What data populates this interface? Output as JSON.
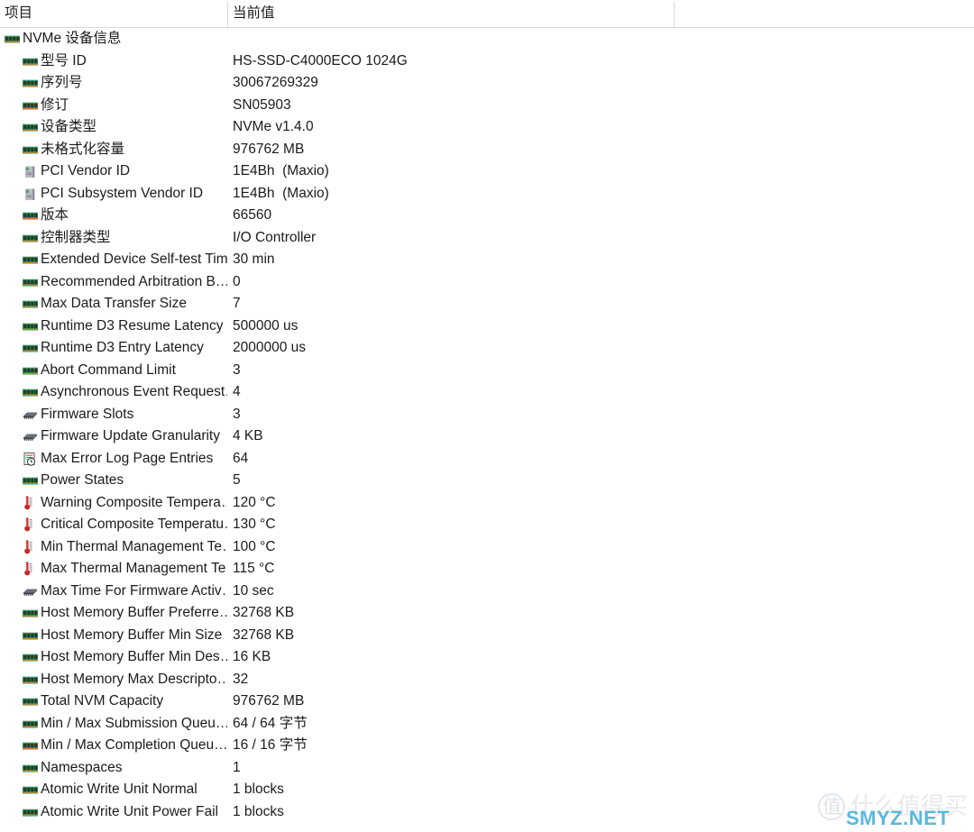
{
  "window": {
    "title": "NVMe 设备信息"
  },
  "header": {
    "columns": [
      {
        "label": "项目"
      },
      {
        "label": "当前值"
      }
    ]
  },
  "colors": {
    "text": "#1b1b1b",
    "grid_line": "#d6d9de",
    "background": "#ffffff",
    "memory_icon_green": "#2f8b57",
    "memory_icon_dark": "#23402f",
    "thermometer_red": "#c62828",
    "chip_icon_grey": "#55585c",
    "watermark_accent": "#5bb8dd",
    "watermark_grey": "#e3e6ea"
  },
  "watermark": {
    "mark_char": "值",
    "brand_cn": "什么值得买",
    "site": "SMYZ.NET"
  },
  "rows": [
    {
      "icon": "memory-icon",
      "depth": 0,
      "label": "NVMe 设备信息",
      "value": ""
    },
    {
      "icon": "memory-icon",
      "depth": 1,
      "label": "型号 ID",
      "value": "HS-SSD-C4000ECO 1024G"
    },
    {
      "icon": "memory-icon",
      "depth": 1,
      "label": "序列号",
      "value": "30067269329"
    },
    {
      "icon": "memory-icon",
      "depth": 1,
      "label": "修订",
      "value": "SN05903"
    },
    {
      "icon": "memory-icon",
      "depth": 1,
      "label": "设备类型",
      "value": "NVMe v1.4.0"
    },
    {
      "icon": "memory-icon",
      "depth": 1,
      "label": "未格式化容量",
      "value": "976762 MB"
    },
    {
      "icon": "tower-icon",
      "depth": 1,
      "label": "PCI Vendor ID",
      "value": "1E4Bh  (Maxio)"
    },
    {
      "icon": "tower-icon",
      "depth": 1,
      "label": "PCI Subsystem Vendor ID",
      "value": "1E4Bh  (Maxio)"
    },
    {
      "icon": "memory-icon",
      "depth": 1,
      "label": "版本",
      "value": "66560"
    },
    {
      "icon": "memory-icon",
      "depth": 1,
      "label": "控制器类型",
      "value": "I/O Controller"
    },
    {
      "icon": "memory-icon",
      "depth": 1,
      "label": "Extended Device Self-test Time",
      "value": "30 min"
    },
    {
      "icon": "memory-icon",
      "depth": 1,
      "label": "Recommended Arbitration B…",
      "value": "0"
    },
    {
      "icon": "memory-icon",
      "depth": 1,
      "label": "Max Data Transfer Size",
      "value": "7"
    },
    {
      "icon": "memory-icon",
      "depth": 1,
      "label": "Runtime D3 Resume Latency",
      "value": "500000 us"
    },
    {
      "icon": "memory-icon",
      "depth": 1,
      "label": "Runtime D3 Entry Latency",
      "value": "2000000 us"
    },
    {
      "icon": "memory-icon",
      "depth": 1,
      "label": "Abort Command Limit",
      "value": "3"
    },
    {
      "icon": "memory-icon",
      "depth": 1,
      "label": "Asynchronous Event Request…",
      "value": "4"
    },
    {
      "icon": "chip-icon",
      "depth": 1,
      "label": "Firmware Slots",
      "value": "3"
    },
    {
      "icon": "chip-icon",
      "depth": 1,
      "label": "Firmware Update Granularity",
      "value": "4 KB"
    },
    {
      "icon": "error-log-icon",
      "depth": 1,
      "label": "Max Error Log Page Entries",
      "value": "64"
    },
    {
      "icon": "memory-icon",
      "depth": 1,
      "label": "Power States",
      "value": "5"
    },
    {
      "icon": "thermometer-icon",
      "depth": 1,
      "label": "Warning Composite Tempera…",
      "value": "120 °C"
    },
    {
      "icon": "thermometer-icon",
      "depth": 1,
      "label": "Critical Composite Temperatu…",
      "value": "130 °C"
    },
    {
      "icon": "thermometer-icon",
      "depth": 1,
      "label": "Min Thermal Management Te…",
      "value": "100 °C"
    },
    {
      "icon": "thermometer-icon",
      "depth": 1,
      "label": "Max Thermal Management Te…",
      "value": "115 °C"
    },
    {
      "icon": "chip-icon",
      "depth": 1,
      "label": "Max Time For Firmware Activ…",
      "value": "10 sec"
    },
    {
      "icon": "memory-icon",
      "depth": 1,
      "label": "Host Memory Buffer Preferre…",
      "value": "32768 KB"
    },
    {
      "icon": "memory-icon",
      "depth": 1,
      "label": "Host Memory Buffer Min Size",
      "value": "32768 KB"
    },
    {
      "icon": "memory-icon",
      "depth": 1,
      "label": "Host Memory Buffer Min Des…",
      "value": "16 KB"
    },
    {
      "icon": "memory-icon",
      "depth": 1,
      "label": "Host Memory Max Descripto…",
      "value": "32"
    },
    {
      "icon": "memory-icon",
      "depth": 1,
      "label": "Total NVM Capacity",
      "value": "976762 MB"
    },
    {
      "icon": "memory-icon",
      "depth": 1,
      "label": "Min / Max Submission Queu…",
      "value": "64 / 64 字节"
    },
    {
      "icon": "memory-icon",
      "depth": 1,
      "label": "Min / Max Completion Queu…",
      "value": "16 / 16 字节"
    },
    {
      "icon": "memory-icon",
      "depth": 1,
      "label": "Namespaces",
      "value": "1"
    },
    {
      "icon": "memory-icon",
      "depth": 1,
      "label": "Atomic Write Unit Normal",
      "value": "1 blocks"
    },
    {
      "icon": "memory-icon",
      "depth": 1,
      "label": "Atomic Write Unit Power Fail",
      "value": "1 blocks"
    }
  ]
}
